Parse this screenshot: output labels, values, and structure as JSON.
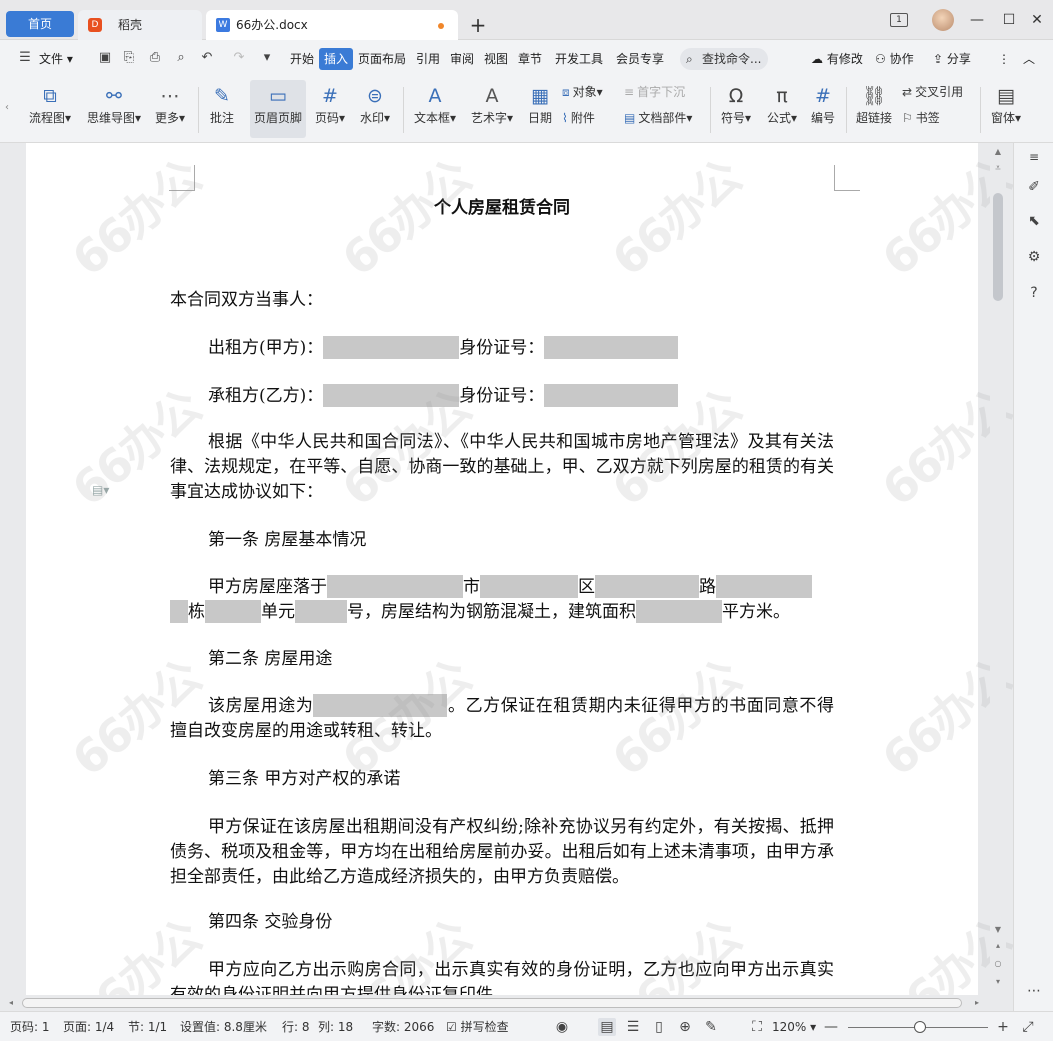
{
  "tabs": {
    "home": "首页",
    "daoke": "稻壳",
    "doc": "66办公.docx",
    "new_tab": "+"
  },
  "window": {
    "num": "1",
    "min": "—",
    "max": "☐",
    "close": "✕"
  },
  "menu": {
    "file": "文件",
    "items": [
      "开始",
      "插入",
      "页面布局",
      "引用",
      "审阅",
      "视图",
      "章节",
      "开发工具",
      "会员专享"
    ],
    "search": "查找命令...",
    "modify": "有修改",
    "collab": "协作",
    "share": "分享"
  },
  "ribbon": {
    "flowchart": "流程图",
    "mindmap": "思维导图",
    "more": "更多",
    "comment": "批注",
    "header_footer": "页眉页脚",
    "page_num": "页码",
    "watermark": "水印",
    "textbox": "文本框",
    "wordart": "艺术字",
    "date": "日期",
    "object": "对象",
    "attachment": "附件",
    "dropcap": "首字下沉",
    "docpart": "文档部件",
    "symbol": "符号",
    "formula": "公式",
    "numbering": "编号",
    "hyperlink": "超链接",
    "crossref": "交叉引用",
    "bookmark": "书签",
    "window": "窗体"
  },
  "document": {
    "title": "个人房屋租赁合同",
    "p1": "本合同双方当事人：",
    "lessor": "出租方(甲方)：",
    "lessee": "承租方(乙方)：",
    "idno": "身份证号：",
    "p2": "根据《中华人民共和国合同法》、《中华人民共和国城市房地产管理法》及其有关法律、法规规定，在平等、自愿、协商一致的基础上，甲、乙双方就下列房屋的租赁的有关事宜达成协议如下：",
    "art1": "第一条  房屋基本情况",
    "a1_located": "甲方房屋座落于",
    "a1_city": "市",
    "a1_district": "区",
    "a1_road": "路",
    "a1_bldg": "栋",
    "a1_unit": "单元",
    "a1_no": "号，房屋结构为钢筋混凝土，建筑面积",
    "a1_sqm": "平方米。",
    "art2": "第二条  房屋用途",
    "a2_text1": "该房屋用途为",
    "a2_text2": "。乙方保证在租赁期内未征得甲方的书面同意不得擅自改变房屋的用途或转租、转让。",
    "art3": "第三条  甲方对产权的承诺",
    "a3_text": "甲方保证在该房屋出租期间没有产权纠纷;除补充协议另有约定外，有关按揭、抵押债务、税项及租金等，甲方均在出租给房屋前办妥。出租后如有上述未清事项，由甲方承担全部责任，由此给乙方造成经济损失的，由甲方负责赔偿。",
    "art4": "第四条  交验身份",
    "a4_text": "甲方应向乙方出示购房合同，出示真实有效的身份证明，乙方也应向甲方出示真实有效的身份证明并向甲方提供身份证复印件"
  },
  "watermark_text": "66办公",
  "status": {
    "page": "页码: 1",
    "pages": "页面: 1/4",
    "section": "节: 1/1",
    "setting": "设置值: 8.8厘米",
    "row": "行: 8",
    "col": "列: 18",
    "words": "字数: 2066",
    "spell": "拼写检查",
    "zoom": "120%"
  }
}
